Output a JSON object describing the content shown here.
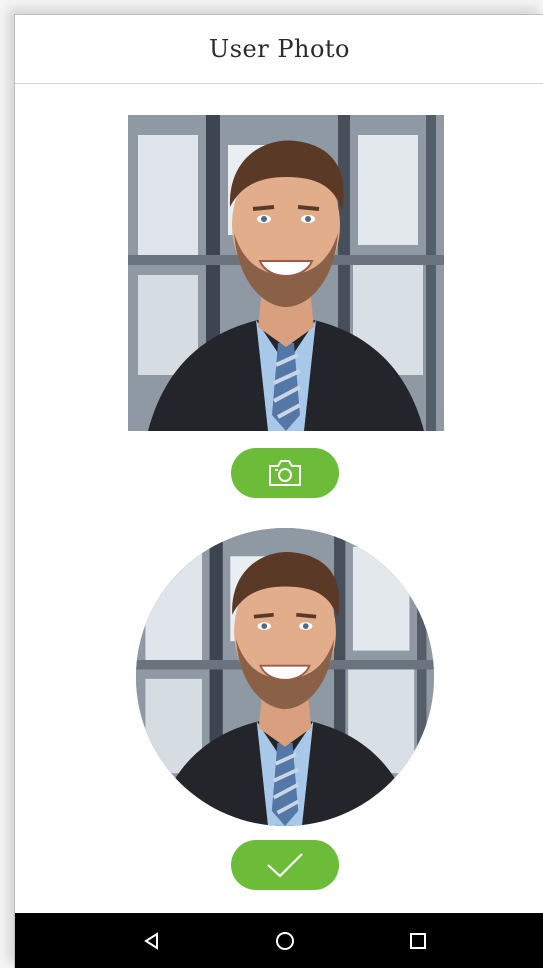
{
  "screen": {
    "title": "User Photo"
  },
  "photo": {
    "subject": "portrait-man-in-suit",
    "background_color": "#9aa3ad"
  },
  "actions": {
    "capture_icon": "camera-icon",
    "confirm_icon": "check-icon",
    "accent_color": "#6cbc3a"
  },
  "navbar": {
    "back_icon": "back-triangle-icon",
    "home_icon": "home-circle-icon",
    "recent_icon": "recent-square-icon"
  }
}
